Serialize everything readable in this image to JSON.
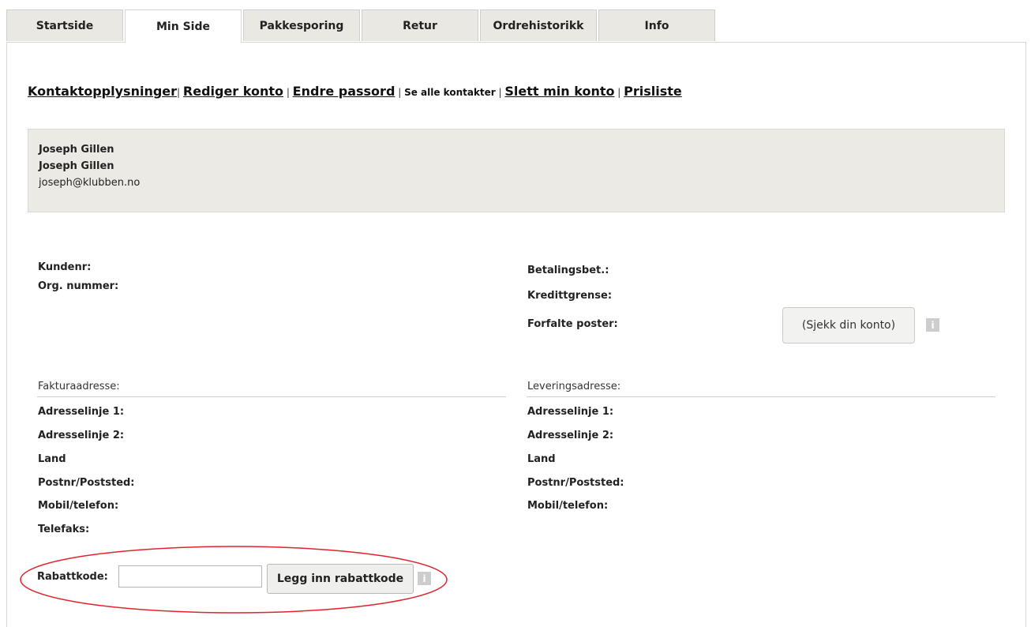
{
  "tabs": [
    "Startside",
    "Min Side",
    "Pakkesporing",
    "Retur",
    "Ordrehistorikk",
    "Info"
  ],
  "subnav": {
    "kontakt": "Kontaktopplysninger",
    "rediger": "Rediger konto",
    "passord": "Endre passord",
    "se_alle": "Se alle kontakter",
    "slett": "Slett min konto",
    "prisliste": "Prisliste"
  },
  "profile": {
    "name1": "Joseph Gillen",
    "name2": "Joseph Gillen",
    "email": "joseph@klubben.no"
  },
  "account": {
    "kundenr": "Kundenr:",
    "org": "Org. nummer:",
    "betaling": "Betalingsbet.:",
    "kreditt": "Kredittgrense:",
    "forfalte": "Forfalte poster:",
    "sjekk_button": "(Sjekk din konto)"
  },
  "faktura": {
    "heading": "Fakturaadresse:",
    "adr1": "Adresselinje 1:",
    "adr2": "Adresselinje 2:",
    "land": "Land",
    "postnr": "Postnr/Poststed:",
    "mobil": "Mobil/telefon:",
    "telefaks": "Telefaks:"
  },
  "levering": {
    "heading": "Leveringsadresse:",
    "adr1": "Adresselinje 1:",
    "adr2": "Adresselinje 2:",
    "land": "Land",
    "postnr": "Postnr/Poststed:",
    "mobil": "Mobil/telefon:"
  },
  "rabatt": {
    "label": "Rabattkode:",
    "value": "",
    "button": "Legg inn rabattkode"
  },
  "info_icon": "i",
  "annotation_color": "#e0242b"
}
